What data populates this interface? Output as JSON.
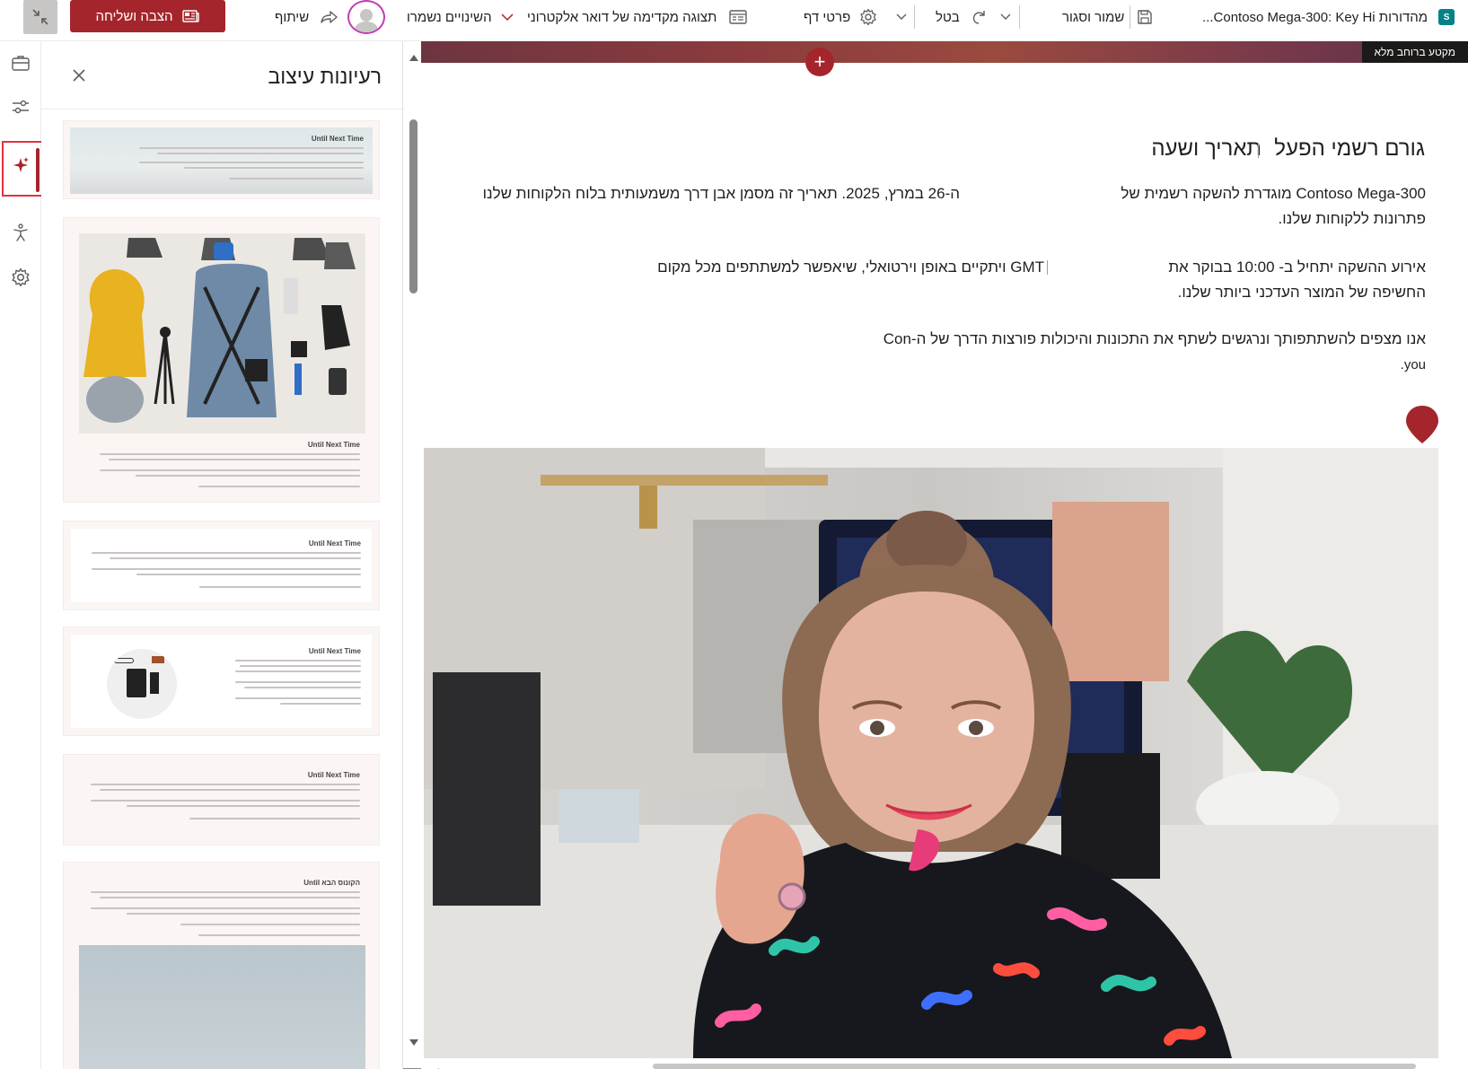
{
  "topbar": {
    "app_badge": "S",
    "doc_title": "מהדורות Contoso Mega-300: Key Hi...",
    "save_close": "שמור וסגור",
    "undo": "בטל",
    "page_details": "פרטי דף",
    "email_preview": "תצוגה מקדימה של דואר אלקטרוני",
    "changes_saved": "השינויים נשמרו",
    "share": "שיתוף",
    "publish": "הצבה ושליחה"
  },
  "panel": {
    "title": "רעיונות עיצוב",
    "thumb_titles": [
      "Until Next Time",
      "Until Next Time",
      "Until Next Time",
      "Until Next Time",
      "Until Next Time",
      "Until הקונוס הבא"
    ]
  },
  "canvas": {
    "full_width_tag": "מקטע ברוחב מלא",
    "col_right_heading": "גורם רשמי הפעל",
    "col_left_heading": "תאריך ושעה",
    "para1_line1": "Contoso Mega-300 מוגדרת להשקה רשמית של",
    "para1_line2": "פתרונות ללקוחות שלנו.",
    "para1_left": "ה-26 במרץ, 2025. תאריך זה מסמן אבן דרך משמעותית בלוח הלקוחות שלנו",
    "para2_line1": "אירוע ההשקה יתחיל ב- 10:00 בבוקר את",
    "para2_line2": "החשיפה של המוצר העדכני ביותר שלנו.",
    "para2_left": "GMT ויתקיים באופן וירטואלי, שיאפשר למשתתפים מכל מקום",
    "para3_line1": "אנו מצפים להשתתפותך ונרגשים לשתף את התכונות והיכולות פורצות הדרך של ה-Con",
    "para3_line2": "you."
  },
  "colors": {
    "accent": "#a4262c",
    "active_outline": "#e0333f",
    "avatar_ring": "#c239b3"
  },
  "icons": {
    "rail": [
      "briefcase-icon",
      "sliders-icon",
      "sparkle-icon",
      "accessibility-icon",
      "gear-icon"
    ]
  }
}
